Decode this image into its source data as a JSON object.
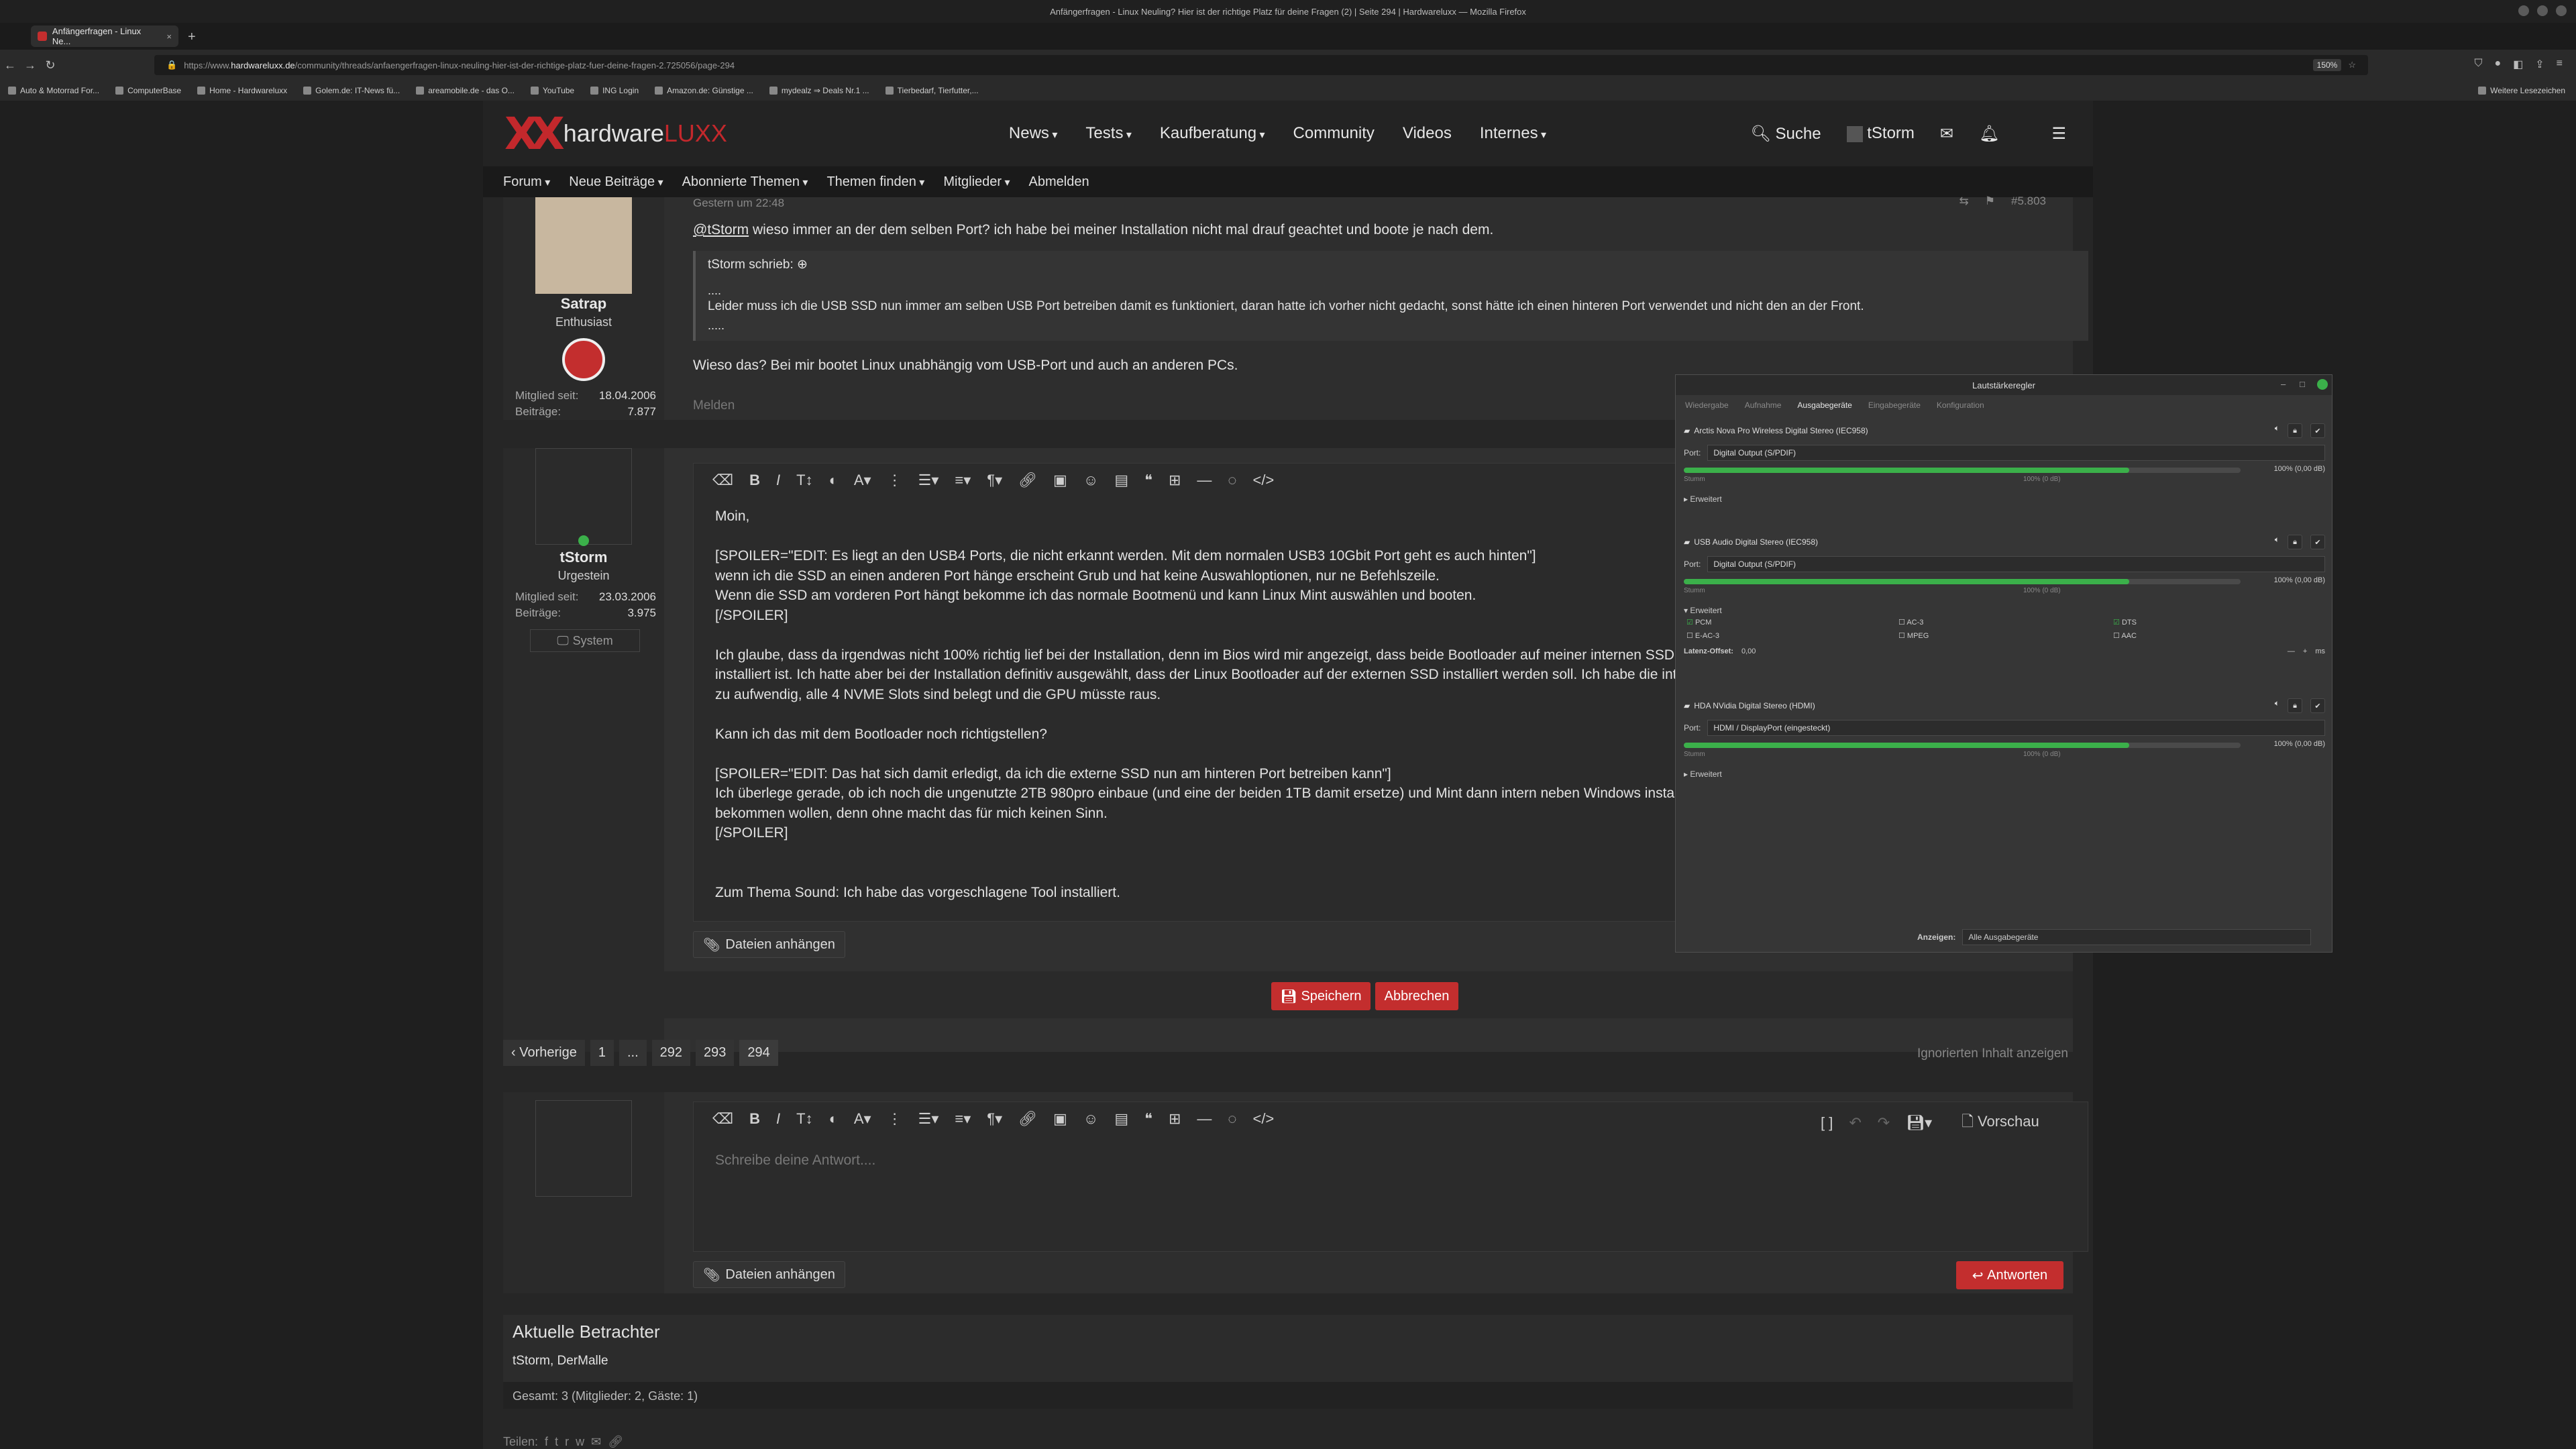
{
  "browser": {
    "window_title": "Anfängerfragen - Linux Neuling? Hier ist der richtige Platz für deine Fragen (2) | Seite 294 | Hardwareluxx — Mozilla Firefox",
    "tab_title": "Anfängerfragen - Linux Ne...",
    "url_prefix": "https://www.",
    "url_host": "hardwareluxx.de",
    "url_path": "/community/threads/anfaengerfragen-linux-neuling-hier-ist-der-richtige-platz-fuer-deine-fragen-2.725056/page-294",
    "zoom": "150%",
    "bookmarks": [
      "Auto & Motorrad For...",
      "ComputerBase",
      "Home - Hardwareluxx",
      "Golem.de: IT-News fü...",
      "areamobile.de - das O...",
      "YouTube",
      "ING Login",
      "Amazon.de: Günstige ...",
      "mydealz ⇒ Deals Nr.1 ...",
      "Tierbedarf, Tierfutter,..."
    ],
    "bookmarks_more": "Weitere Lesezeichen"
  },
  "forum": {
    "logo_main": "hardware",
    "logo_accent": "LUXX",
    "nav": [
      "News",
      "Tests",
      "Kaufberatung",
      "Community",
      "Videos",
      "Internes"
    ],
    "search_label": "Suche",
    "user_label": "tStorm",
    "subnav": [
      "Forum",
      "Neue Beiträge",
      "Abonnierte Themen",
      "Themen finden",
      "Mitglieder",
      "Abmelden"
    ]
  },
  "post1": {
    "time": "Gestern um 22:48",
    "post_no": "#5.803",
    "username": "Satrap",
    "usertitle": "Enthusiast",
    "member_since_label": "Mitglied seit:",
    "member_since": "18.04.2006",
    "posts_label": "Beiträge:",
    "posts": "7.877",
    "mention": "@tStorm",
    "line1": " wieso immer an der dem selben Port? ich habe bei meiner Installation nicht mal drauf geachtet und boote je nach dem.",
    "quote_header": "tStorm schrieb:",
    "quote_dots1": "....",
    "quote_text": "Leider muss ich die USB SSD nun immer am selben USB Port betreiben damit es funktioniert, daran hatte ich vorher nicht gedacht, sonst hätte ich einen hinteren Port verwendet und nicht den an der Front.",
    "quote_dots2": ".....",
    "line2": "Wieso das? Bei mir bootet Linux unabhängig vom USB-Port und auch an anderen PCs.",
    "report": "Melden"
  },
  "post2": {
    "username": "tStorm",
    "usertitle": "Urgestein",
    "member_since_label": "Mitglied seit:",
    "member_since": "23.03.2006",
    "posts_label": "Beiträge:",
    "posts": "3.975",
    "system_label": "System",
    "lines": [
      "Moin,",
      "",
      "[SPOILER=\"EDIT: Es liegt an den USB4 Ports, die nicht erkannt werden. Mit dem normalen USB3 10Gbit Port geht es auch hinten\"]",
      "wenn ich die SSD an einen anderen Port hänge erscheint Grub und hat keine Auswahloptionen, nur ne Befehlszeile.",
      "Wenn die SSD am vorderen Port hängt bekomme ich das normale Bootmenü und kann Linux Mint auswählen und booten.",
      "[/SPOILER]",
      "",
      "Ich glaube, dass da irgendwas nicht 100% richtig lief bei der Installation, denn im Bios wird mir angezeigt, dass beide Bootloader auf meiner internen SSD (die",
      "installiert ist. Ich hatte aber bei der Installation definitiv ausgewählt, dass der Linux Bootloader auf der externen SSD installiert werden soll. Ich habe die intern",
      "zu aufwendig, alle 4 NVME Slots sind belegt und die GPU müsste raus.",
      "",
      "Kann ich das mit dem Bootloader noch richtigstellen?",
      "",
      "[SPOILER=\"EDIT: Das hat sich damit erledigt, da ich die externe SSD nun am hinteren Port betreiben kann\"]",
      "Ich überlege gerade, ob ich noch die ungenutzte 2TB 980pro einbaue (und eine der beiden 1TB damit ersetze) und Mint dann intern neben Windows installier",
      "bekommen wollen, denn ohne macht das für mich keinen Sinn.",
      "[/SPOILER]",
      "",
      "",
      "Zum Thema Sound: Ich habe das vorgeschlagene Tool installiert."
    ],
    "attach_label": "Dateien anhängen",
    "save_label": "Speichern",
    "cancel_label": "Abbrechen"
  },
  "pagination": {
    "prev_label": "Vorherige",
    "pages": [
      "1",
      "...",
      "292",
      "293",
      "294"
    ],
    "ignored_label": "Ignorierten Inhalt anzeigen"
  },
  "reply": {
    "placeholder": "Schreibe deine Antwort....",
    "preview_label": "Vorschau",
    "attach_label": "Dateien anhängen",
    "submit_label": "Antworten"
  },
  "viewers": {
    "heading": "Aktuelle Betrachter",
    "names": "tStorm, DerMalle",
    "total": "Gesamt: 3 (Mitglieder: 2, Gäste: 1)",
    "share_label": "Teilen:"
  },
  "volume": {
    "title": "Lautstärkeregler",
    "tabs": [
      "Wiedergabe",
      "Aufnahme",
      "Ausgabegeräte",
      "Eingabegeräte",
      "Konfiguration"
    ],
    "active_tab": "Ausgabegeräte",
    "port_label": "Port:",
    "silence_label": "Stumm",
    "full_label": "100% (0 dB)",
    "expand_label": "Erweitert",
    "devices": [
      {
        "name": "Arctis Nova Pro Wireless Digital Stereo (IEC958)",
        "port": "Digital Output (S/PDIF)",
        "level": "100% (0,00 dB)",
        "fill": 0.8
      },
      {
        "name": "USB Audio Digital Stereo (IEC958)",
        "port": "Digital Output (S/PDIF)",
        "level": "100% (0,00 dB)",
        "fill": 0.8
      },
      {
        "name": "HDA NVidia Digital Stereo (HDMI)",
        "port": "HDMI / DisplayPort (eingesteckt)",
        "level": "100% (0,00 dB)",
        "fill": 0.8
      }
    ],
    "codecs": [
      "PCM",
      "AC-3",
      "DTS",
      "E-AC-3",
      "MPEG",
      "AAC"
    ],
    "latency_label": "Latenz-Offset:",
    "latency_value": "0,00",
    "latency_unit": "ms",
    "show_label": "Anzeigen:",
    "show_value": "Alle Ausgabegeräte"
  }
}
